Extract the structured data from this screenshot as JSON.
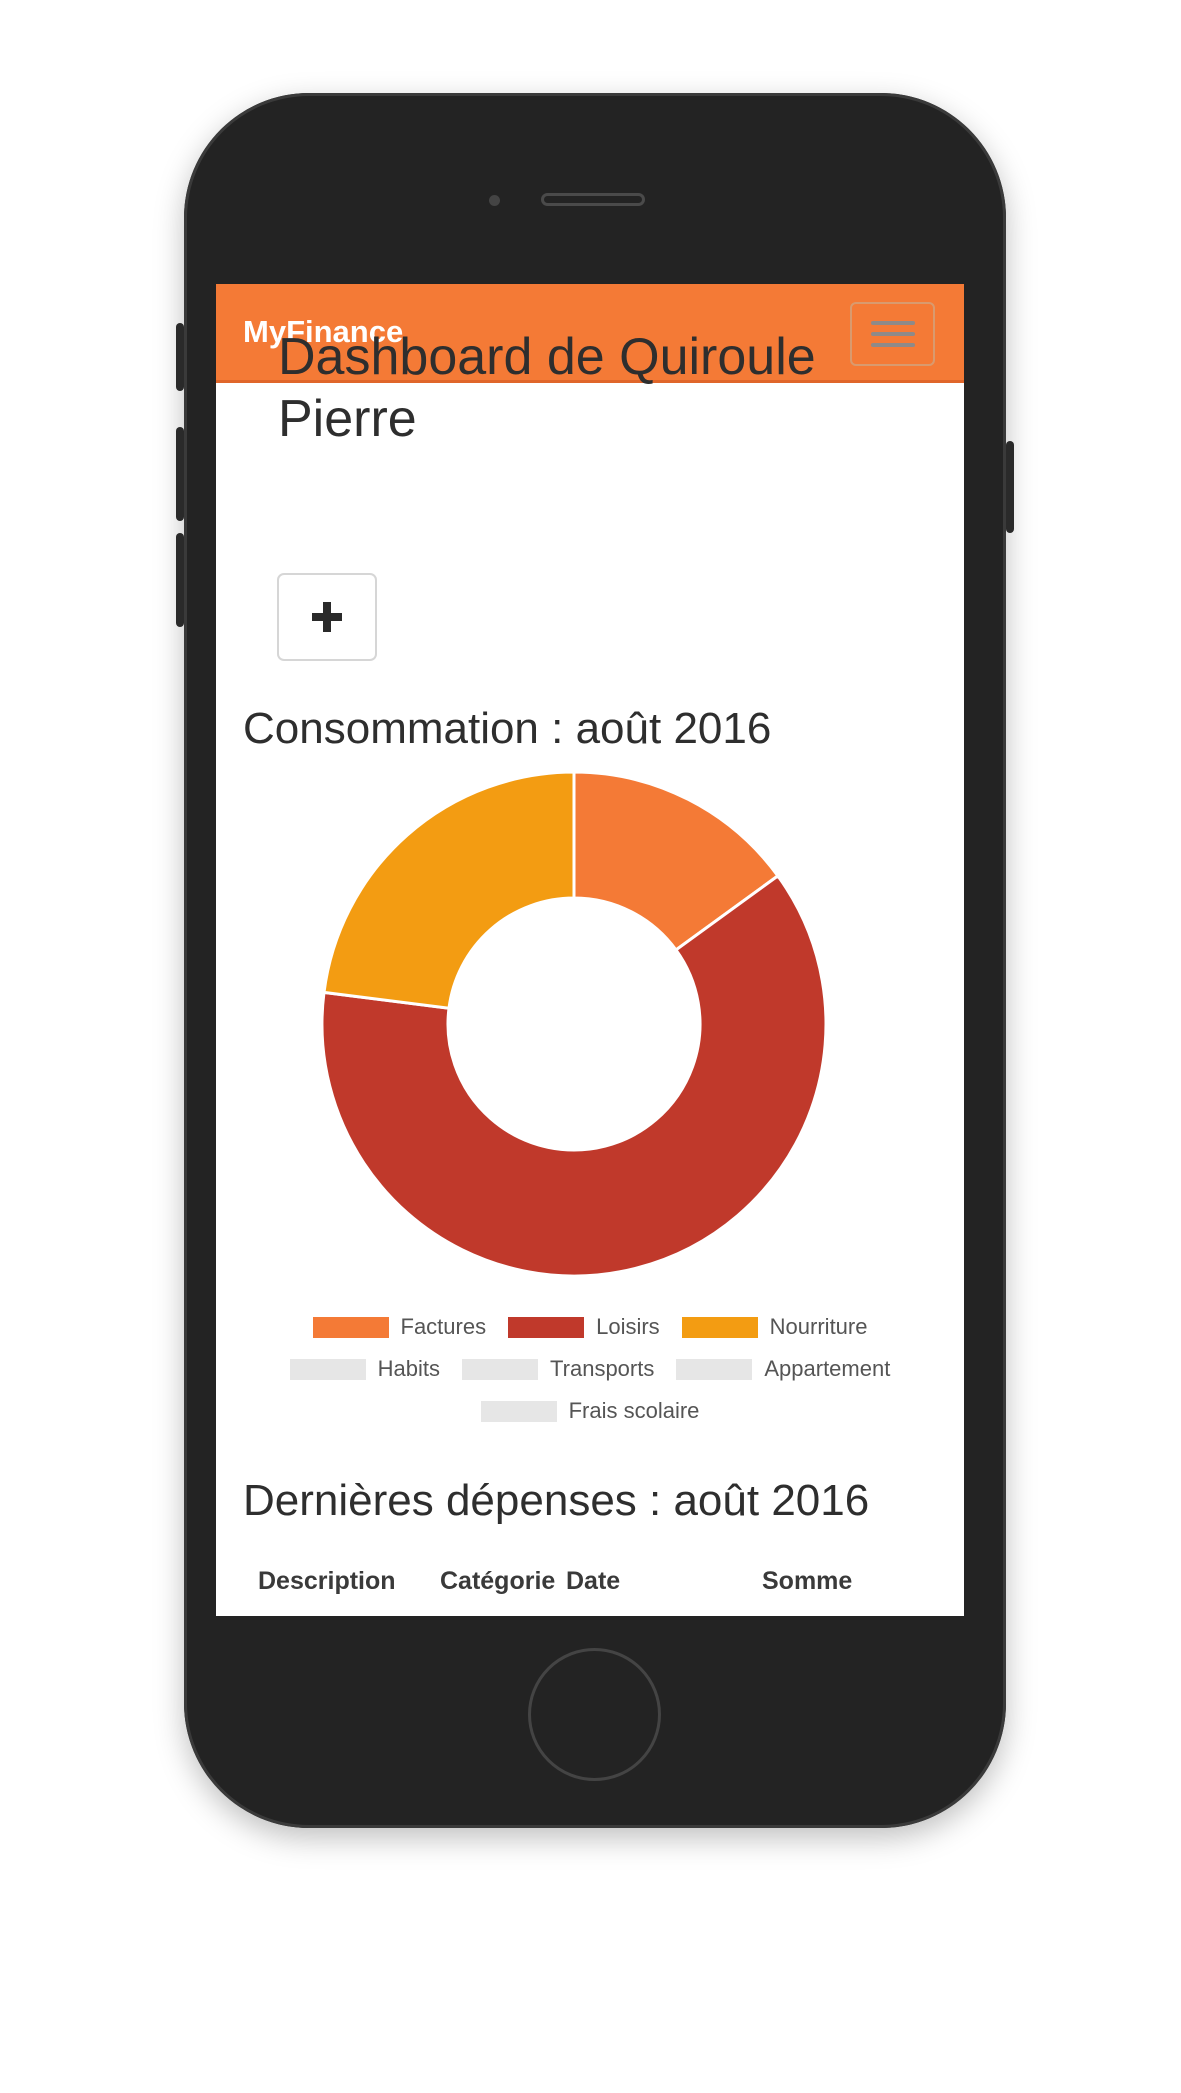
{
  "app": {
    "brand": "MyFinance",
    "accent": "#f47a36"
  },
  "page": {
    "title": "Dashboard de Quiroule Pierre",
    "add_button_icon": "plus-icon",
    "menu_icon": "hamburger-icon"
  },
  "consumption": {
    "heading": "Consommation : août 2016"
  },
  "chart_data": {
    "type": "pie",
    "title": "Consommation : août 2016",
    "categories": [
      "Factures",
      "Loisirs",
      "Nourriture",
      "Habits",
      "Transports",
      "Appartement",
      "Frais scolaire"
    ],
    "values": [
      15,
      62,
      23,
      0,
      0,
      0,
      0
    ],
    "colors": [
      "#f47a36",
      "#c0392b",
      "#f39c12",
      "#e6e6e6",
      "#e6e6e6",
      "#e6e6e6",
      "#e6e6e6"
    ],
    "hole_ratio": 0.5,
    "legend_placement": "bottom"
  },
  "expenses": {
    "heading": "Dernières dépenses : août 2016",
    "columns": [
      "Description",
      "Catégorie",
      "Date",
      "Somme"
    ]
  }
}
